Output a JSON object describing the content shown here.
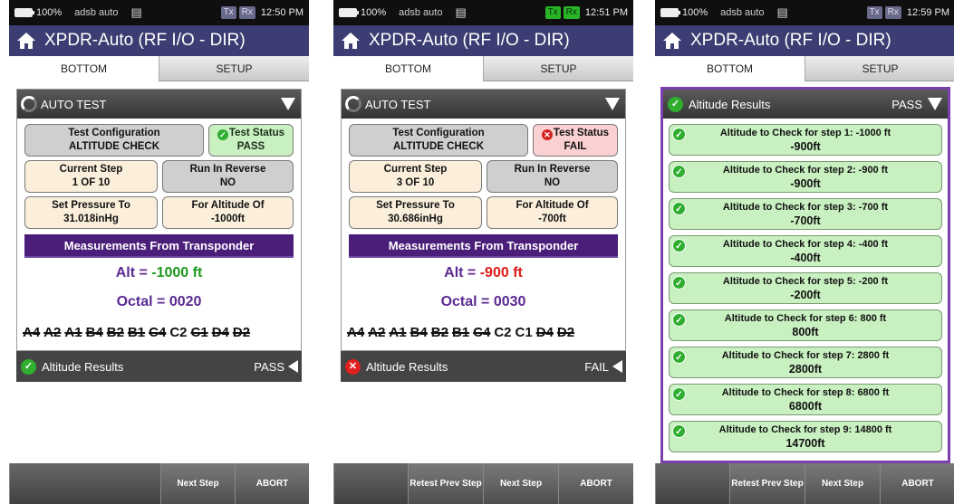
{
  "status": {
    "battery": "100%",
    "mode": "adsb auto",
    "tx": "Tx",
    "rx": "Rx"
  },
  "app": {
    "title": "XPDR-Auto (RF I/O - DIR)"
  },
  "tabs": {
    "bottom": "BOTTOM",
    "setup": "SETUP"
  },
  "colors": {
    "title_bar": "#3c3d72",
    "measurement_bar": "#4b1e7a",
    "pass_green": "#2fae2f",
    "fail_red": "#e01f1f"
  },
  "screens": [
    {
      "time": "12:50 PM",
      "tx_active": false,
      "panel_title": "AUTO TEST",
      "cfg_label": "Test Configuration",
      "cfg_value": "ALTITUDE CHECK",
      "status_label": "Test Status",
      "status_value": "PASS",
      "step_label": "Current Step",
      "step_value": "1 OF 10",
      "reverse_label": "Run In Reverse",
      "reverse_value": "NO",
      "pressure_label": "Set Pressure To",
      "pressure_value": "31.018inHg",
      "for_alt_label": "For Altitude Of",
      "for_alt_value": "-1000ft",
      "meas_title": "Measurements From Transponder",
      "alt_prefix": "Alt = ",
      "alt_value": "-1000 ft",
      "octal_text": "Octal = 0020",
      "codes": [
        {
          "t": "A4",
          "off": true
        },
        {
          "t": "A2",
          "off": true
        },
        {
          "t": "A1",
          "off": true
        },
        {
          "t": "B4",
          "off": true
        },
        {
          "t": "B2",
          "off": true
        },
        {
          "t": "B1",
          "off": true
        },
        {
          "t": "C4",
          "off": true
        },
        {
          "t": "C2",
          "off": false
        },
        {
          "t": "C1",
          "off": true
        },
        {
          "t": "D4",
          "off": true
        },
        {
          "t": "D2",
          "off": true
        }
      ],
      "results_label": "Altitude Results",
      "results_status": "PASS",
      "buttons": [
        "",
        "Next Step",
        "ABORT"
      ]
    },
    {
      "time": "12:51 PM",
      "tx_active": true,
      "panel_title": "AUTO TEST",
      "cfg_label": "Test Configuration",
      "cfg_value": "ALTITUDE CHECK",
      "status_label": "Test Status",
      "status_value": "FAIL",
      "step_label": "Current Step",
      "step_value": "3 OF 10",
      "reverse_label": "Run In Reverse",
      "reverse_value": "NO",
      "pressure_label": "Set Pressure To",
      "pressure_value": "30.686inHg",
      "for_alt_label": "For Altitude Of",
      "for_alt_value": "-700ft",
      "meas_title": "Measurements From Transponder",
      "alt_prefix": "Alt = ",
      "alt_value": "-900 ft",
      "octal_text": "Octal = 0030",
      "codes": [
        {
          "t": "A4",
          "off": true
        },
        {
          "t": "A2",
          "off": true
        },
        {
          "t": "A1",
          "off": true
        },
        {
          "t": "B4",
          "off": true
        },
        {
          "t": "B2",
          "off": true
        },
        {
          "t": "B1",
          "off": true
        },
        {
          "t": "C4",
          "off": true
        },
        {
          "t": "C2",
          "off": false
        },
        {
          "t": "C1",
          "off": false
        },
        {
          "t": "D4",
          "off": true
        },
        {
          "t": "D2",
          "off": true
        }
      ],
      "results_label": "Altitude Results",
      "results_status": "FAIL",
      "buttons": [
        "",
        "Retest Prev Step",
        "Next Step",
        "ABORT"
      ]
    },
    {
      "time": "12:59 PM",
      "tx_active": false,
      "results_label": "Altitude Results",
      "results_status": "PASS",
      "steps": [
        {
          "label": "Altitude to Check for step 1: -1000 ft",
          "value": "-900ft"
        },
        {
          "label": "Altitude to Check for step 2: -900 ft",
          "value": "-900ft"
        },
        {
          "label": "Altitude to Check for step 3: -700 ft",
          "value": "-700ft"
        },
        {
          "label": "Altitude to Check for step 4: -400 ft",
          "value": "-400ft"
        },
        {
          "label": "Altitude to Check for step 5: -200 ft",
          "value": "-200ft"
        },
        {
          "label": "Altitude to Check for step 6:  800 ft",
          "value": "800ft"
        },
        {
          "label": "Altitude to Check for step 7:  2800 ft",
          "value": "2800ft"
        },
        {
          "label": "Altitude to Check for step 8:  6800 ft",
          "value": "6800ft"
        },
        {
          "label": "Altitude to Check for step 9: 14800 ft",
          "value": "14700ft"
        }
      ],
      "buttons": [
        "",
        "Retest Prev Step",
        "Next Step",
        "ABORT"
      ]
    }
  ]
}
